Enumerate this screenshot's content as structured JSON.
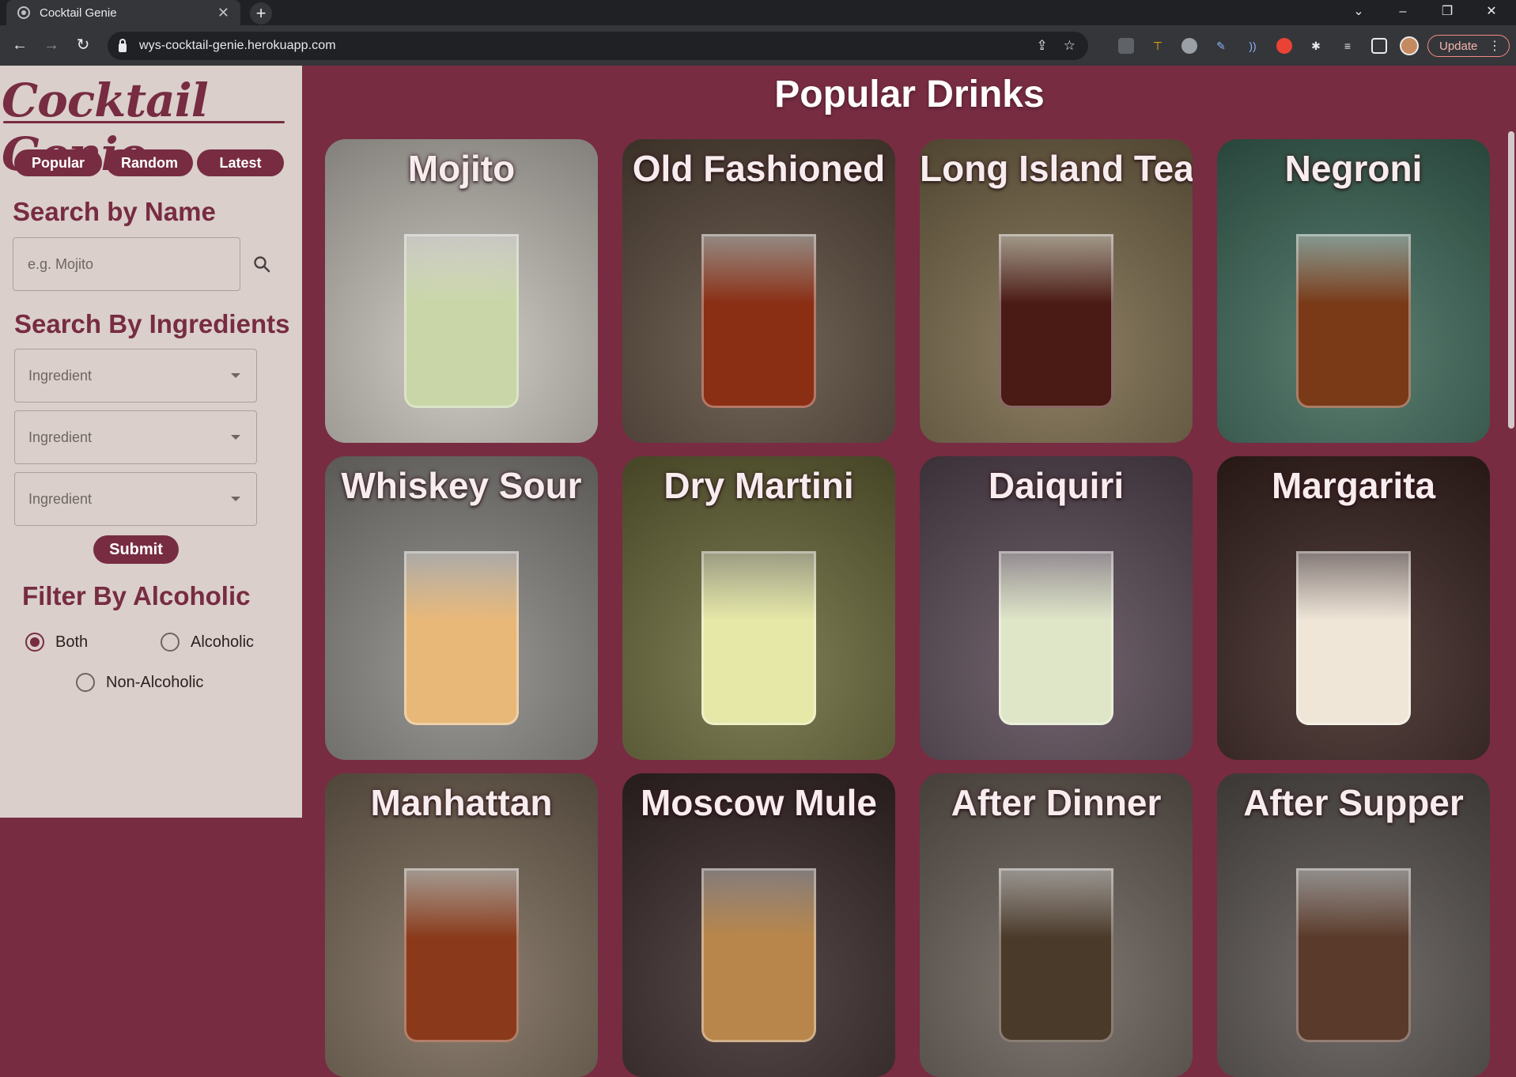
{
  "browser": {
    "tab_title": "Cocktail Genie",
    "tab_close": "✕",
    "new_tab": "+",
    "url": "wys-cocktail-genie.herokuapp.com",
    "update_label": "Update"
  },
  "sidebar": {
    "logo": "Cocktail Genie",
    "nav": [
      "Popular",
      "Random",
      "Latest"
    ],
    "search_name_heading": "Search by Name",
    "search_placeholder": "e.g. Mojito",
    "search_ingredients_heading": "Search By Ingredients",
    "ingredient_selects": [
      "Ingredient",
      "Ingredient",
      "Ingredient"
    ],
    "submit_label": "Submit",
    "filter_heading": "Filter By Alcoholic",
    "filter_options": [
      {
        "label": "Both",
        "checked": true
      },
      {
        "label": "Alcoholic",
        "checked": false
      },
      {
        "label": "Non-Alcoholic",
        "checked": false
      }
    ]
  },
  "main": {
    "title": "Popular Drinks",
    "drinks": [
      {
        "name": "Mojito",
        "bg": "#c8c4bc",
        "drink": "#c9d6a8"
      },
      {
        "name": "Old Fashioned",
        "bg": "#5a4a3c",
        "drink": "#8a2e14"
      },
      {
        "name": "Long Island Tea",
        "bg": "#7a6a4a",
        "drink": "#4a1a14"
      },
      {
        "name": "Negroni",
        "bg": "#3e6a5a",
        "drink": "#7a3a18"
      },
      {
        "name": "Whiskey Sour",
        "bg": "#8a8884",
        "drink": "#e8b878"
      },
      {
        "name": "Dry Martini",
        "bg": "#6a6a3a",
        "drink": "#e6e8a8"
      },
      {
        "name": "Daiquiri",
        "bg": "#5a4a56",
        "drink": "#dfe6c8"
      },
      {
        "name": "Margarita",
        "bg": "#3a2420",
        "drink": "#efe6d8"
      },
      {
        "name": "Manhattan",
        "bg": "#7a6a58",
        "drink": "#8a3a1a"
      },
      {
        "name": "Moscow Mule",
        "bg": "#3a2a2a",
        "drink": "#b8864a"
      },
      {
        "name": "After Dinner",
        "bg": "#6a6058",
        "drink": "#4a3a2a"
      },
      {
        "name": "After Supper",
        "bg": "#5a5450",
        "drink": "#5a3a2a"
      }
    ]
  }
}
